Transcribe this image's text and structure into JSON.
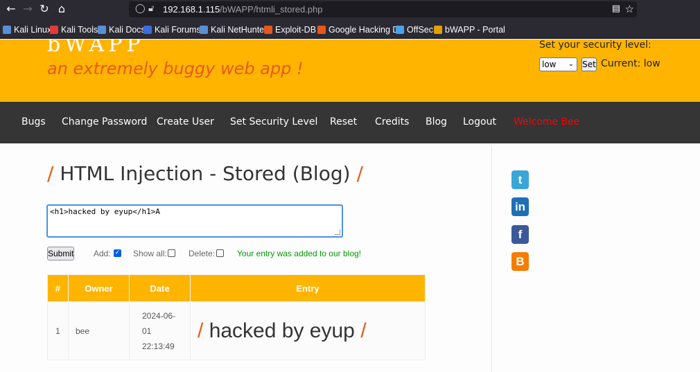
{
  "browser": {
    "url_host": "192.168.1.115",
    "url_path": "/bWAPP/htmli_stored.php",
    "bookmarks": [
      {
        "label": "Kali Linux",
        "color": "#5a8fd6"
      },
      {
        "label": "Kali Tools",
        "color": "#e23a3a"
      },
      {
        "label": "Kali Docs",
        "color": "#5a8fd6"
      },
      {
        "label": "Kali Forums",
        "color": "#3d6bd8"
      },
      {
        "label": "Kali NetHunter",
        "color": "#5a8fd6"
      },
      {
        "label": "Exploit-DB",
        "color": "#e8571d"
      },
      {
        "label": "Google Hacking DB",
        "color": "#e8571d"
      },
      {
        "label": "OffSec",
        "color": "#4aa3e8"
      },
      {
        "label": "bWAPP - Portal",
        "color": "#e0a000"
      }
    ]
  },
  "header": {
    "logo_fragment": "bWAPP",
    "tagline": "an extremely buggy web app !",
    "security_label": "Set your security level:",
    "security_selected": "low",
    "set_button": "Set",
    "current_label": "Current: low"
  },
  "menu": {
    "items": [
      "Bugs",
      "Change Password",
      "Create User",
      "Set Security Level",
      "Reset",
      "Credits",
      "Blog",
      "Logout"
    ],
    "welcome": "Welcome Bee"
  },
  "main": {
    "title": "HTML Injection - Stored (Blog)",
    "title_slash": "/",
    "textarea_value": "<h1>hacked by eyup</h1>A",
    "submit_label": "Submit",
    "add_label": "Add:",
    "show_all_label": "Show all:",
    "delete_label": "Delete:",
    "add_checked": true,
    "show_all_checked": false,
    "delete_checked": false,
    "status": "Your entry was added to our blog!",
    "table": {
      "headers": [
        "#",
        "Owner",
        "Date",
        "Entry"
      ],
      "rows": [
        {
          "num": "1",
          "owner": "bee",
          "date": "2024-06-01",
          "time": "22:13:49",
          "entry": "hacked by eyup"
        }
      ]
    }
  },
  "social": [
    {
      "name": "twitter",
      "glyph": "t",
      "color": "#3aa6d8"
    },
    {
      "name": "linkedin",
      "glyph": "in",
      "color": "#1f6fb5"
    },
    {
      "name": "facebook",
      "glyph": "f",
      "color": "#3b5998"
    },
    {
      "name": "blogger",
      "glyph": "B",
      "color": "#f57d00"
    }
  ],
  "colors": {
    "accent": "#ffb400",
    "brand_orange": "#e85a1c",
    "menu_bg": "#353535",
    "welcome": "#ff0000",
    "success": "#009900"
  }
}
